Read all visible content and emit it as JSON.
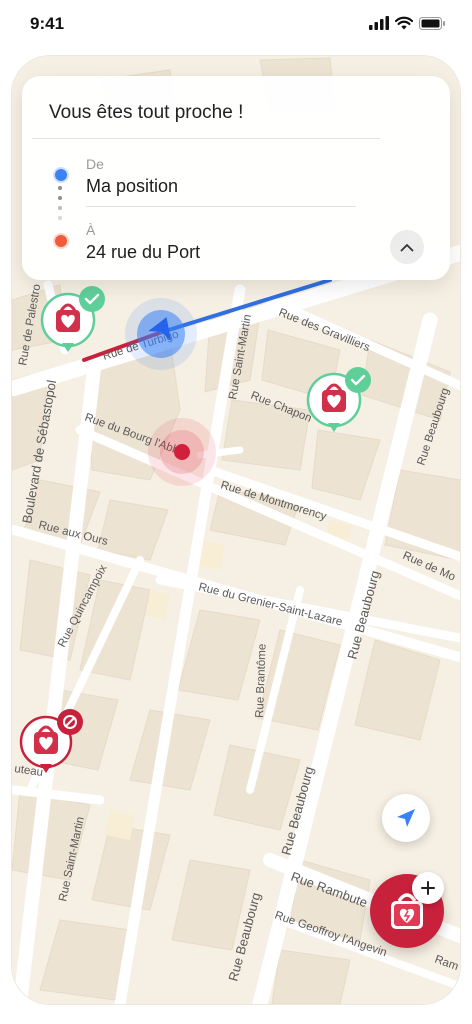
{
  "status_bar": {
    "time": "9:41"
  },
  "route_card": {
    "title": "Vous êtes tout proche !",
    "origin": {
      "label": "De",
      "value": "Ma position"
    },
    "destination": {
      "label": "À",
      "value": "24 rue du Port"
    }
  },
  "map": {
    "streets": {
      "rue_de_palestro": "Rue de Palestro",
      "boulevard_de_sebastopol": "Boulevard de Sébastopol",
      "rue_de_turbigo": "Rue de Turbigo",
      "rue_du_bourg_labbe": "Rue du Bourg l'Abbé",
      "rue_saint_martin_top": "Rue Saint-Martin",
      "rue_des_gravilliers": "Rue des Gravilliers",
      "rue_chapon": "Rue Chapon",
      "rue_beaubourg_right": "Rue Beaubourg",
      "rue_de_montmorency": "Rue de Montmorency",
      "rue_aux_ours": "Rue aux Ours",
      "rue_quincampoix": "Rue Quincampoix",
      "rue_du_grenier_saint_lazare": "Rue du Grenier-Saint-Lazare",
      "rue_de_mo": "Rue de Mo",
      "rue_beaubourg_mid": "Rue Beaubourg",
      "rue_brantome": "Rue Brantôme",
      "rue_beaubourg_low": "Rue Beaubourg",
      "rue_beaubourg_bottom": "Rue Beaubourg",
      "rue_saint_martin_bottom": "Rue Saint-Martin",
      "rue_rambuteau": "Rue Rambute",
      "rue_geoffroy_langevin": "Rue Geoffroy l'Angevin",
      "ram": "Ram",
      "uteau": "uteau"
    },
    "markers": [
      {
        "name": "defibrillator-marker-verified",
        "status": "verified"
      },
      {
        "name": "defibrillator-marker-verified",
        "status": "verified"
      },
      {
        "name": "defibrillator-marker-unavailable",
        "status": "unavailable"
      }
    ]
  },
  "colors": {
    "brand_red": "#c8213c",
    "route_blue": "#2f6fe0",
    "verified_green": "#5fcf9a",
    "origin_blue": "#3b82f6",
    "destination_orange": "#ef5b3b"
  },
  "icons": {
    "collapse": "chevron-up-icon",
    "locate": "navigation-arrow-icon",
    "add": "plus-icon"
  }
}
